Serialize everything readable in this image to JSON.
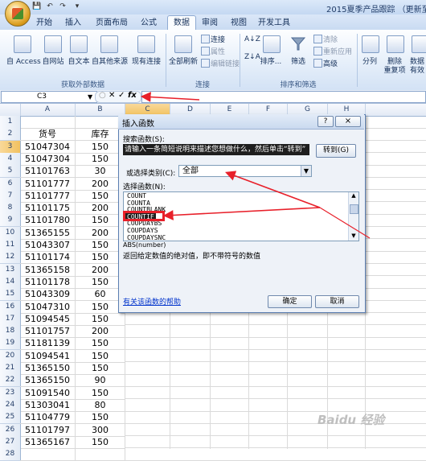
{
  "window": {
    "title": "2015夏季产品跟踪 （更新至5.0"
  },
  "quick_access": {
    "items": [
      "save-icon",
      "undo-icon",
      "redo-icon",
      "customize-icon"
    ]
  },
  "tabs": [
    "开始",
    "插入",
    "页面布局",
    "公式",
    "数据",
    "审阅",
    "视图",
    "开发工具"
  ],
  "active_tab": "数据",
  "ribbon": {
    "group_get_external": {
      "label": "获取外部数据",
      "buttons": [
        "自 Access",
        "自网站",
        "自文本",
        "自其他来源",
        "现有连接"
      ]
    },
    "group_connections": {
      "label": "连接",
      "refresh_all": "全部刷新",
      "items": [
        "连接",
        "属性",
        "编辑链接"
      ]
    },
    "group_sort_filter": {
      "label": "排序和筛选",
      "sort": "排序...",
      "filter": "筛选",
      "items": [
        "清除",
        "重新应用",
        "高级"
      ]
    },
    "group_data_tools": {
      "buttons": [
        "分列",
        "删除",
        "重复项",
        "数据",
        "有效"
      ]
    }
  },
  "formula_bar": {
    "name_box": "C3",
    "fx": "fx",
    "formula": ""
  },
  "columns": [
    "A",
    "B",
    "C",
    "D",
    "E",
    "F",
    "G",
    "H"
  ],
  "selected_column": "C",
  "rows": [
    {
      "n": "1",
      "a": "",
      "b": ""
    },
    {
      "n": "2",
      "a": "货号",
      "b": "库存"
    },
    {
      "n": "3",
      "a": "51047304",
      "b": "150"
    },
    {
      "n": "4",
      "a": "51047304",
      "b": "150"
    },
    {
      "n": "5",
      "a": "51101763",
      "b": "30"
    },
    {
      "n": "6",
      "a": "51101777",
      "b": "200"
    },
    {
      "n": "7",
      "a": "51101777",
      "b": "150"
    },
    {
      "n": "8",
      "a": "51101175",
      "b": "200"
    },
    {
      "n": "9",
      "a": "51101780",
      "b": "150"
    },
    {
      "n": "10",
      "a": "51365155",
      "b": "200"
    },
    {
      "n": "11",
      "a": "51043307",
      "b": "150"
    },
    {
      "n": "12",
      "a": "51101174",
      "b": "150"
    },
    {
      "n": "13",
      "a": "51365158",
      "b": "200"
    },
    {
      "n": "14",
      "a": "51101178",
      "b": "150"
    },
    {
      "n": "15",
      "a": "51043309",
      "b": "60"
    },
    {
      "n": "16",
      "a": "51047310",
      "b": "150"
    },
    {
      "n": "17",
      "a": "51094545",
      "b": "150"
    },
    {
      "n": "18",
      "a": "51101757",
      "b": "200"
    },
    {
      "n": "19",
      "a": "51181139",
      "b": "150"
    },
    {
      "n": "20",
      "a": "51094541",
      "b": "150"
    },
    {
      "n": "21",
      "a": "51365150",
      "b": "150"
    },
    {
      "n": "22",
      "a": "51365150",
      "b": "90"
    },
    {
      "n": "23",
      "a": "51091540",
      "b": "150"
    },
    {
      "n": "24",
      "a": "51303041",
      "b": "80"
    },
    {
      "n": "25",
      "a": "51104779",
      "b": "150"
    },
    {
      "n": "26",
      "a": "51101797",
      "b": "300"
    },
    {
      "n": "27",
      "a": "51365167",
      "b": "150"
    },
    {
      "n": "28",
      "a": "",
      "b": ""
    }
  ],
  "selected_row": "3",
  "dialog": {
    "title": "插入函数",
    "help_icon": "?",
    "close_icon": "×",
    "search_label": "搜索函数(S):",
    "search_value": "请输入一条简短说明来描述您想做什么，然后单击“转到”",
    "go_button": "转到(G)",
    "category_label": "或选择类别(C):",
    "category_value": "全部",
    "select_label": "选择函数(N):",
    "functions": [
      "COUNT",
      "COUNTA",
      "COUNTBLANK",
      "COUNTIF",
      "COUPDAYBS",
      "COUPDAYS",
      "COUPDAYSNC"
    ],
    "selected_function": "COUNTIF",
    "syntax": "ABS(number)",
    "description": "返回给定数值的绝对值，即不带符号的数值",
    "help_link": "有关该函数的帮助",
    "ok_button": "确定",
    "cancel_button": "取消"
  },
  "annotation_color": "#e8202a",
  "watermark": "Baidu 经验"
}
